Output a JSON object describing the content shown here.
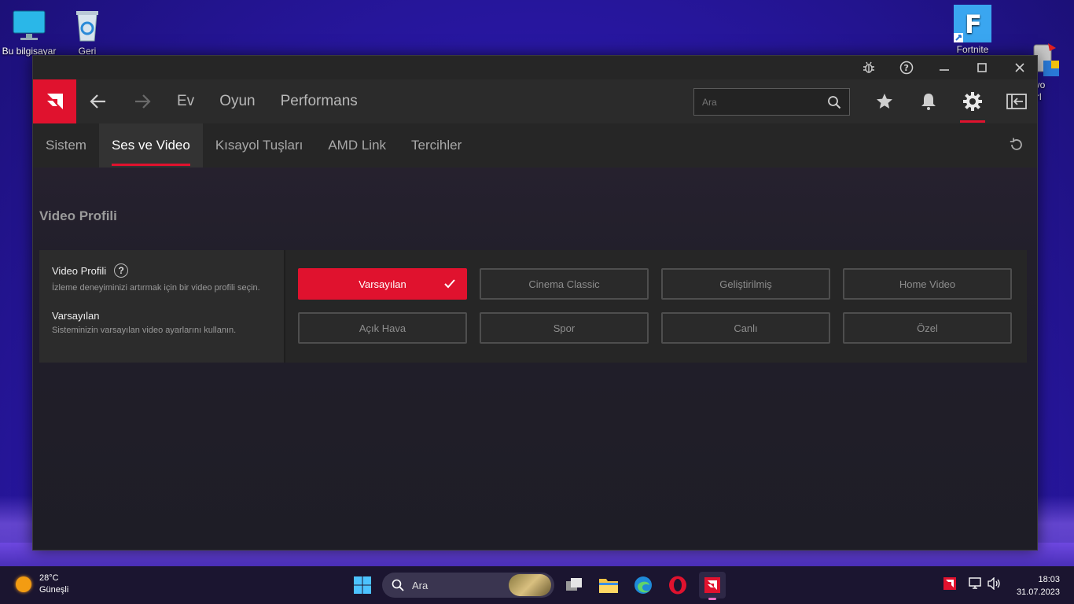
{
  "desktop": {
    "icons": [
      {
        "label": "Bu bilgisayar"
      },
      {
        "label": "Geri"
      },
      {
        "label": "Fortnite"
      },
      {
        "label": "Revo\nallerl"
      }
    ]
  },
  "window": {
    "titlebar": {
      "icons": [
        "bug-icon",
        "help-icon",
        "minimize-icon",
        "maximize-icon",
        "close-icon"
      ]
    },
    "nav": {
      "links": [
        "Ev",
        "Oyun",
        "Performans"
      ],
      "search_placeholder": "Ara"
    },
    "subtabs": [
      "Sistem",
      "Ses ve Video",
      "Kısayol Tuşları",
      "AMD Link",
      "Tercihler"
    ],
    "active_subtab": "Ses ve Video",
    "section_title": "Video Profili",
    "panel": {
      "title": "Video Profili",
      "description": "İzleme deneyiminizi artırmak için bir video profili seçin.",
      "selected_title": "Varsayılan",
      "selected_description": "Sisteminizin varsayılan video ayarlarını kullanın."
    },
    "options": [
      "Varsayılan",
      "Cinema Classic",
      "Geliştirilmiş",
      "Home Video",
      "Açık Hava",
      "Spor",
      "Canlı",
      "Özel"
    ],
    "selected_option": "Varsayılan",
    "accent": "#e0122e"
  },
  "taskbar": {
    "weather_temp": "28°C",
    "weather_text": "Güneşli",
    "search_label": "Ara",
    "time": "18:03",
    "date": "31.07.2023"
  }
}
